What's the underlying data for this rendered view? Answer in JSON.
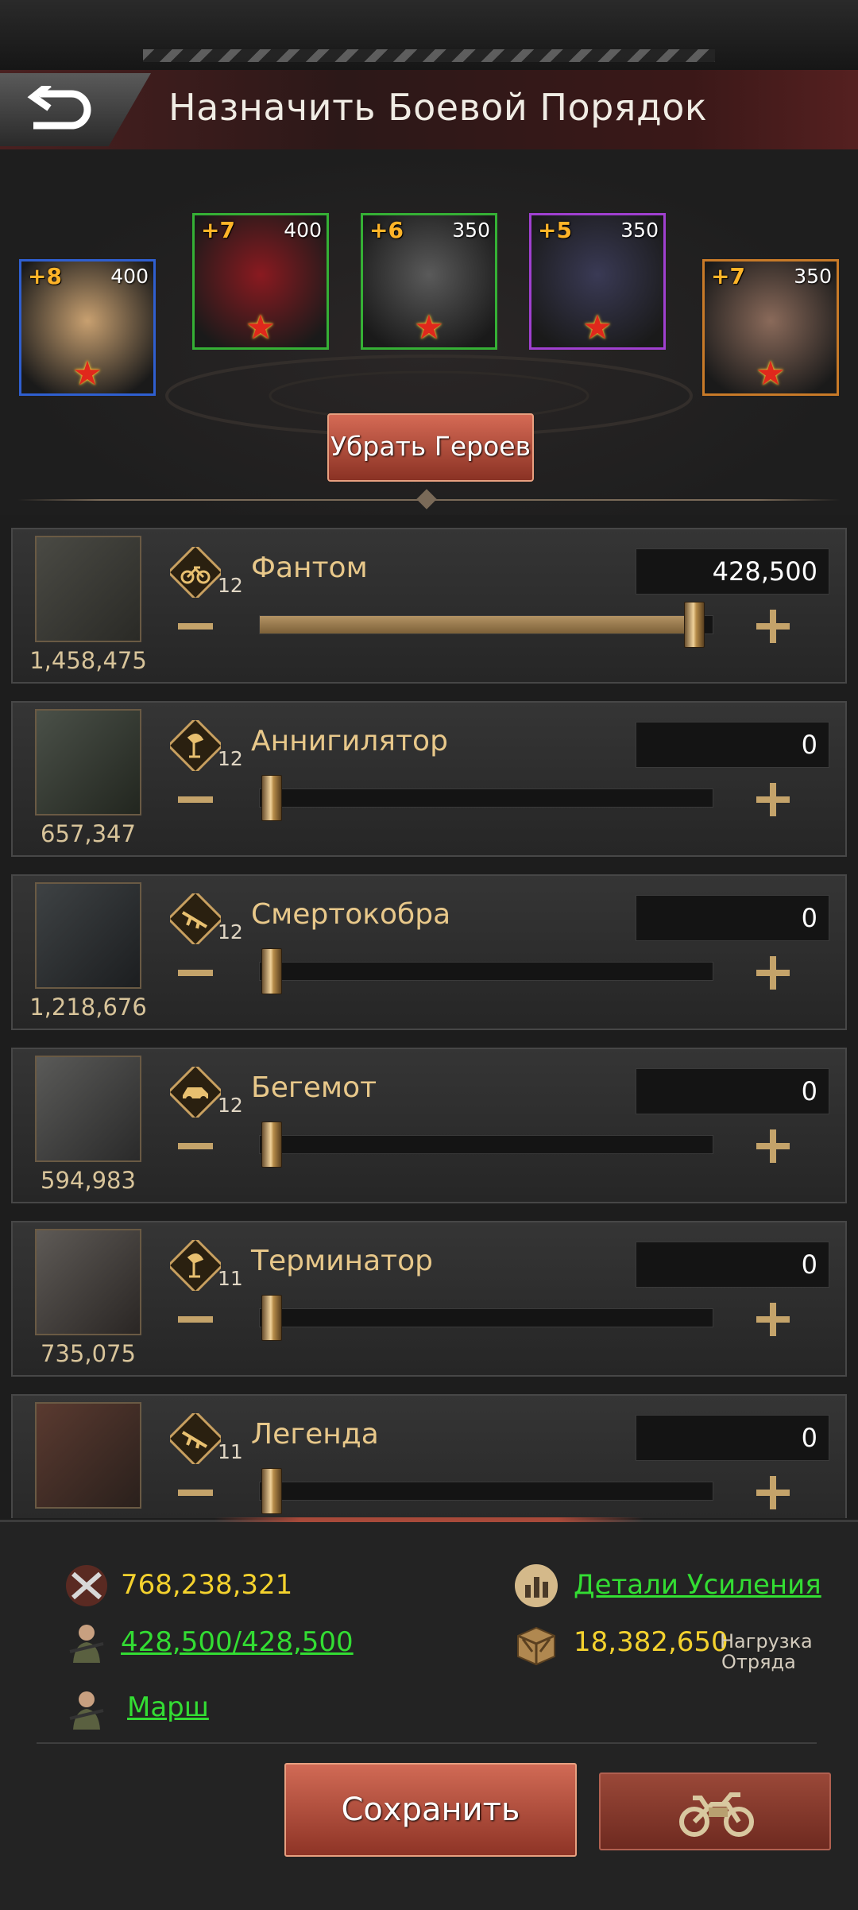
{
  "header": {
    "title": "Назначить Боевой Порядок"
  },
  "heroes": [
    {
      "level": "+8",
      "power": "400",
      "frame_color": "#2f5fd0",
      "bg": "#c8a070"
    },
    {
      "level": "+7",
      "power": "400",
      "frame_color": "#35b035",
      "bg": "#8a1a20"
    },
    {
      "level": "+6",
      "power": "350",
      "frame_color": "#35b035",
      "bg": "#5a5a5a"
    },
    {
      "level": "+5",
      "power": "350",
      "frame_color": "#a040d0",
      "bg": "#3a3a55"
    },
    {
      "level": "+7",
      "power": "350",
      "frame_color": "#c87a28",
      "bg": "#8a6a5a"
    }
  ],
  "remove_heroes_label": "Убрать Героев",
  "troops": [
    {
      "name": "Фантом",
      "tier": "12",
      "available": "1,458,475",
      "value": "428,500",
      "fill": 0.96,
      "type_icon": "motorcycle-icon"
    },
    {
      "name": "Аннигилятор",
      "tier": "12",
      "available": "657,347",
      "value": "0",
      "fill": 0,
      "type_icon": "shovel-icon"
    },
    {
      "name": "Смертокобра",
      "tier": "12",
      "available": "1,218,676",
      "value": "0",
      "fill": 0,
      "type_icon": "rifle-icon"
    },
    {
      "name": "Бегемот",
      "tier": "12",
      "available": "594,983",
      "value": "0",
      "fill": 0,
      "type_icon": "car-icon"
    },
    {
      "name": "Терминатор",
      "tier": "11",
      "available": "735,075",
      "value": "0",
      "fill": 0,
      "type_icon": "shovel-icon"
    },
    {
      "name": "Легенда",
      "tier": "11",
      "available": "",
      "value": "0",
      "fill": 0,
      "type_icon": "rifle-icon"
    }
  ],
  "summary": {
    "power": "768,238,321",
    "troops": "428,500/428,500",
    "march": "Марш",
    "boost_details": "Детали Усиления",
    "load": "18,382,650",
    "load_label_line1": "Нагрузка",
    "load_label_line2": "Отряда"
  },
  "save_label": "Сохранить",
  "colors": {
    "accent": "#c4a36a",
    "gold_text": "#f4d22e",
    "link": "#33dd33",
    "button": "#b04a38"
  }
}
